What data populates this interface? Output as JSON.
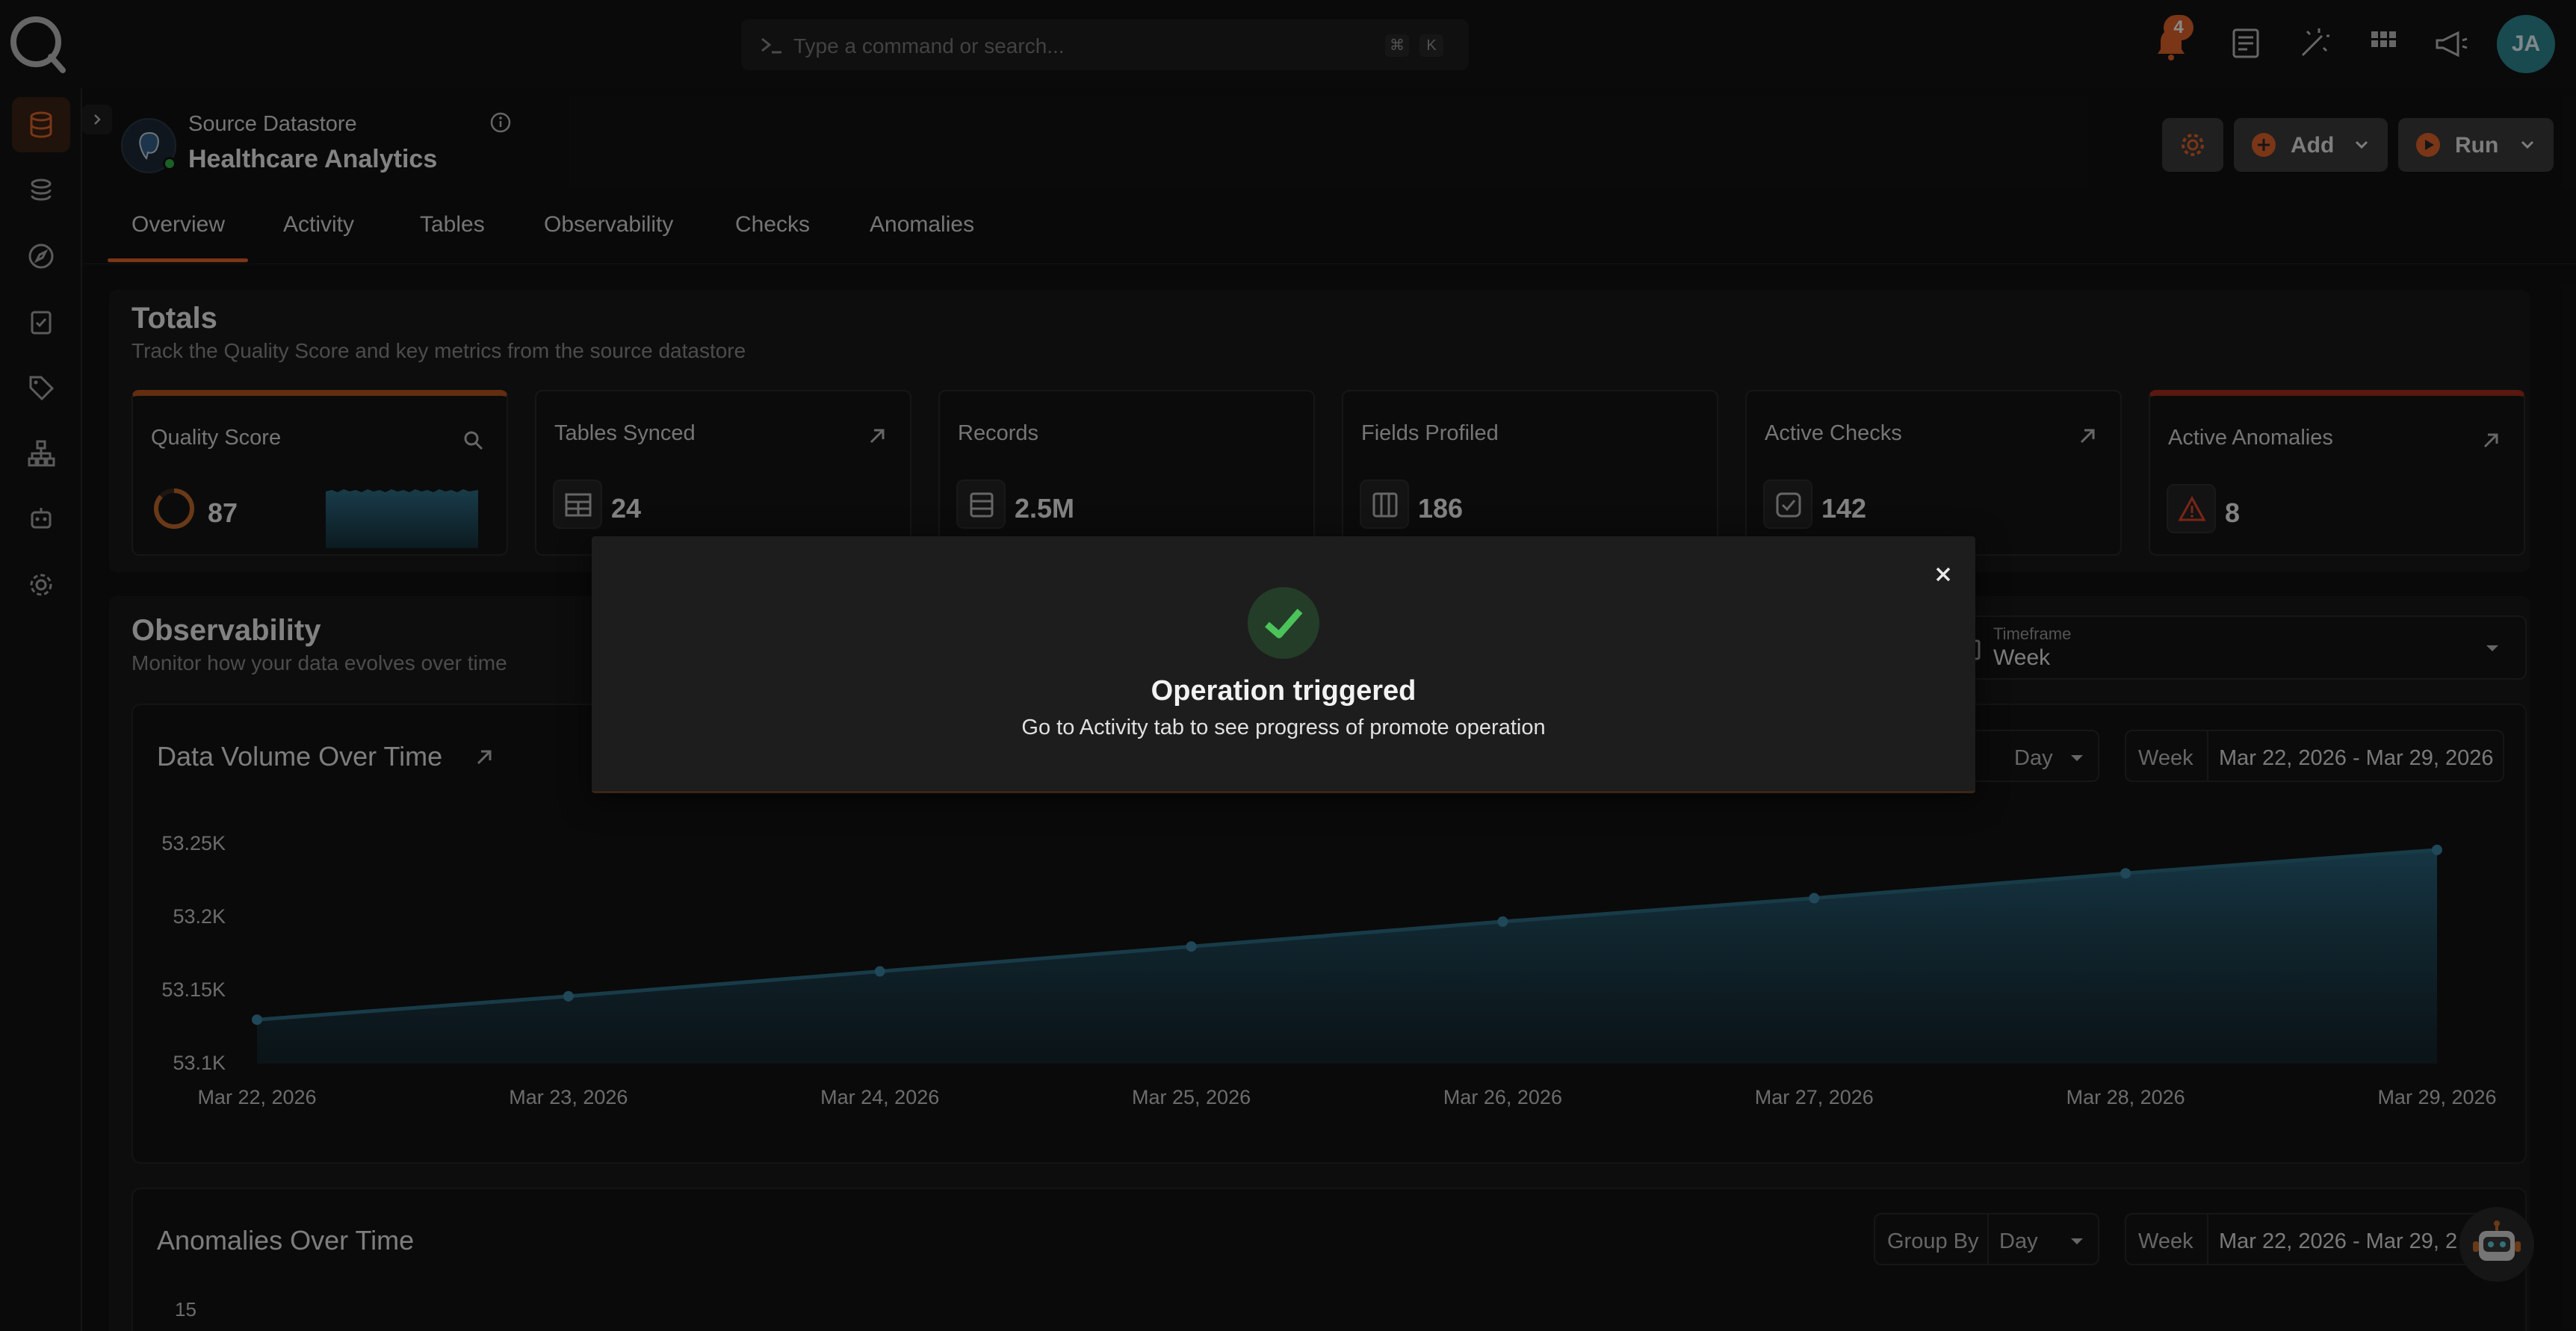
{
  "topbar": {
    "search_placeholder": "Type a command or search...",
    "shortcut_mod": "⌘",
    "shortcut_key": "K",
    "notification_count": "4",
    "user_initials": "JA"
  },
  "header": {
    "label": "Source Datastore",
    "name": "Healthcare Analytics",
    "add_label": "Add",
    "run_label": "Run"
  },
  "tabs": [
    {
      "label": "Overview",
      "active": true
    },
    {
      "label": "Activity"
    },
    {
      "label": "Tables"
    },
    {
      "label": "Observability"
    },
    {
      "label": "Checks"
    },
    {
      "label": "Anomalies"
    }
  ],
  "totals": {
    "title": "Totals",
    "subtitle": "Track the Quality Score and key metrics from the source datastore",
    "metrics": [
      {
        "label": "Quality Score",
        "value": "87",
        "icon": "search-icon"
      },
      {
        "label": "Tables Synced",
        "value": "24",
        "icon": "table-icon"
      },
      {
        "label": "Records",
        "value": "2.5M",
        "icon": "records-icon"
      },
      {
        "label": "Fields Profiled",
        "value": "186",
        "icon": "columns-icon"
      },
      {
        "label": "Active Checks",
        "value": "142",
        "icon": "check-square-icon"
      },
      {
        "label": "Active Anomalies",
        "value": "8",
        "icon": "warning-icon"
      }
    ]
  },
  "observability": {
    "title": "Observability",
    "subtitle": "Monitor how your data evolves over time",
    "timeframe_label": "Timeframe",
    "timeframe_value": "Week"
  },
  "volume_chart": {
    "title": "Data Volume Over Time",
    "group_value": "Day",
    "range_label": "Week",
    "range_value": "Mar 22, 2026 - Mar 29, 2026"
  },
  "anomalies_chart": {
    "title": "Anomalies Over Time",
    "group_label": "Group By",
    "group_value": "Day",
    "range_label": "Week",
    "range_value": "Mar 22, 2026 - Mar 29, 2",
    "y_first_tick": "15"
  },
  "chart_data": {
    "type": "area",
    "title": "Data Volume Over Time",
    "x": [
      "Mar 22, 2026",
      "Mar 23, 2026",
      "Mar 24, 2026",
      "Mar 25, 2026",
      "Mar 26, 2026",
      "Mar 27, 2026",
      "Mar 28, 2026",
      "Mar 29, 2026"
    ],
    "values": [
      53130,
      53146,
      53163,
      53180,
      53197,
      53213,
      53230,
      53246
    ],
    "yticks": [
      "53.25K",
      "53.2K",
      "53.15K",
      "53.1K"
    ],
    "ylim": [
      53100,
      53250
    ],
    "grid": false,
    "color": "#2d6e86"
  },
  "dialog": {
    "title": "Operation triggered",
    "message": "Go to Activity tab to see progress of promote operation"
  },
  "colors": {
    "accent": "#e2652b",
    "success": "#4cc25a",
    "danger": "#e2452b"
  }
}
